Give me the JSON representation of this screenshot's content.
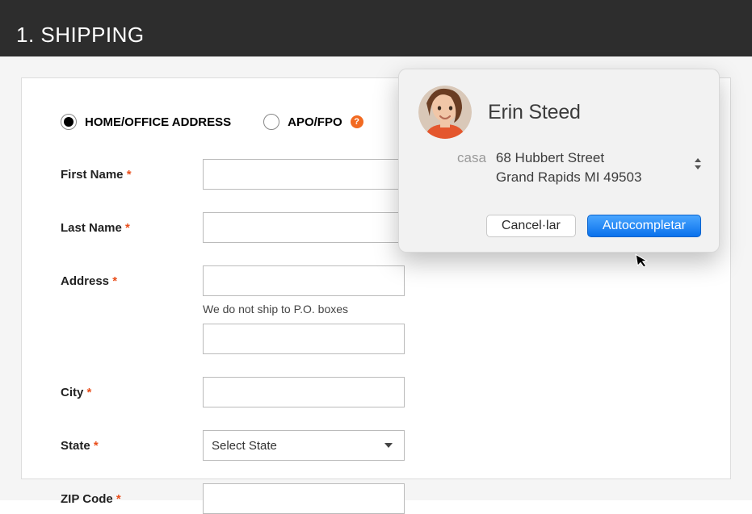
{
  "header": {
    "title": "1. SHIPPING"
  },
  "radios": {
    "home_office": "HOME/OFFICE ADDRESS",
    "apo_fpo": "APO/FPO",
    "help_glyph": "?"
  },
  "form": {
    "first_name": {
      "label": "First Name ",
      "req": "*",
      "value": ""
    },
    "last_name": {
      "label": "Last Name ",
      "req": "*",
      "value": ""
    },
    "address": {
      "label": "Address ",
      "req": "*",
      "value": "",
      "hint": "We do not ship to P.O. boxes",
      "value2": ""
    },
    "city": {
      "label": "City ",
      "req": "*",
      "value": ""
    },
    "state": {
      "label": "State ",
      "req": "*",
      "placeholder": "Select State"
    },
    "zip": {
      "label": "ZIP Code ",
      "req": "*",
      "value": ""
    }
  },
  "popover": {
    "name": "Erin Steed",
    "address_label": "casa",
    "line1": "68 Hubbert Street",
    "line2": "Grand Rapids MI 49503",
    "cancel": "Cancel·lar",
    "autocomplete": "Autocompletar"
  }
}
